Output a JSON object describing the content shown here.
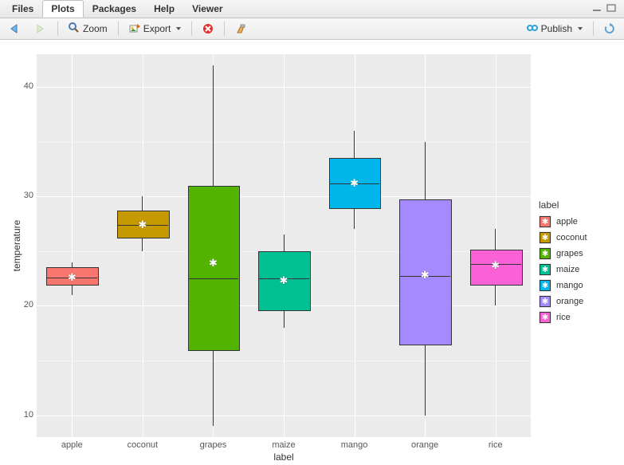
{
  "tabs": [
    "Files",
    "Plots",
    "Packages",
    "Help",
    "Viewer"
  ],
  "active_tab": 1,
  "toolbar": {
    "back": "Back",
    "forward": "Forward",
    "zoom": "Zoom",
    "export": "Export",
    "remove": "Remove the current plot",
    "clear": "Clear all plots",
    "publish": "Publish",
    "refresh": "Refresh"
  },
  "chart_data": {
    "type": "boxplot",
    "xlabel": "label",
    "ylabel": "temperature",
    "y_ticks": [
      10,
      20,
      30,
      40
    ],
    "ylim": [
      8,
      43
    ],
    "categories": [
      "apple",
      "coconut",
      "grapes",
      "maize",
      "mango",
      "orange",
      "rice"
    ],
    "series": [
      {
        "name": "apple",
        "color": "#f8766d",
        "min": 21.0,
        "q1": 22.0,
        "median": 22.6,
        "q3": 23.5,
        "max": 24.0,
        "mean": 22.6
      },
      {
        "name": "coconut",
        "color": "#c49a00",
        "min": 25.0,
        "q1": 26.3,
        "median": 27.4,
        "q3": 28.7,
        "max": 30.0,
        "mean": 27.4
      },
      {
        "name": "grapes",
        "color": "#53b400",
        "min": 9.0,
        "q1": 16.0,
        "median": 22.5,
        "q3": 31.0,
        "max": 42.0,
        "mean": 23.9
      },
      {
        "name": "maize",
        "color": "#00c094",
        "min": 18.0,
        "q1": 19.7,
        "median": 22.5,
        "q3": 25.0,
        "max": 26.5,
        "mean": 22.3
      },
      {
        "name": "mango",
        "color": "#00b6eb",
        "min": 27.0,
        "q1": 29.0,
        "median": 31.2,
        "q3": 33.5,
        "max": 36.0,
        "mean": 31.2
      },
      {
        "name": "orange",
        "color": "#a58aff",
        "min": 10.0,
        "q1": 16.5,
        "median": 22.7,
        "q3": 29.7,
        "max": 35.0,
        "mean": 22.8
      },
      {
        "name": "rice",
        "color": "#fb61d7",
        "min": 20.0,
        "q1": 22.0,
        "median": 23.8,
        "q3": 25.1,
        "max": 27.0,
        "mean": 23.7
      }
    ],
    "legend": {
      "title": "label",
      "position": "right"
    }
  }
}
